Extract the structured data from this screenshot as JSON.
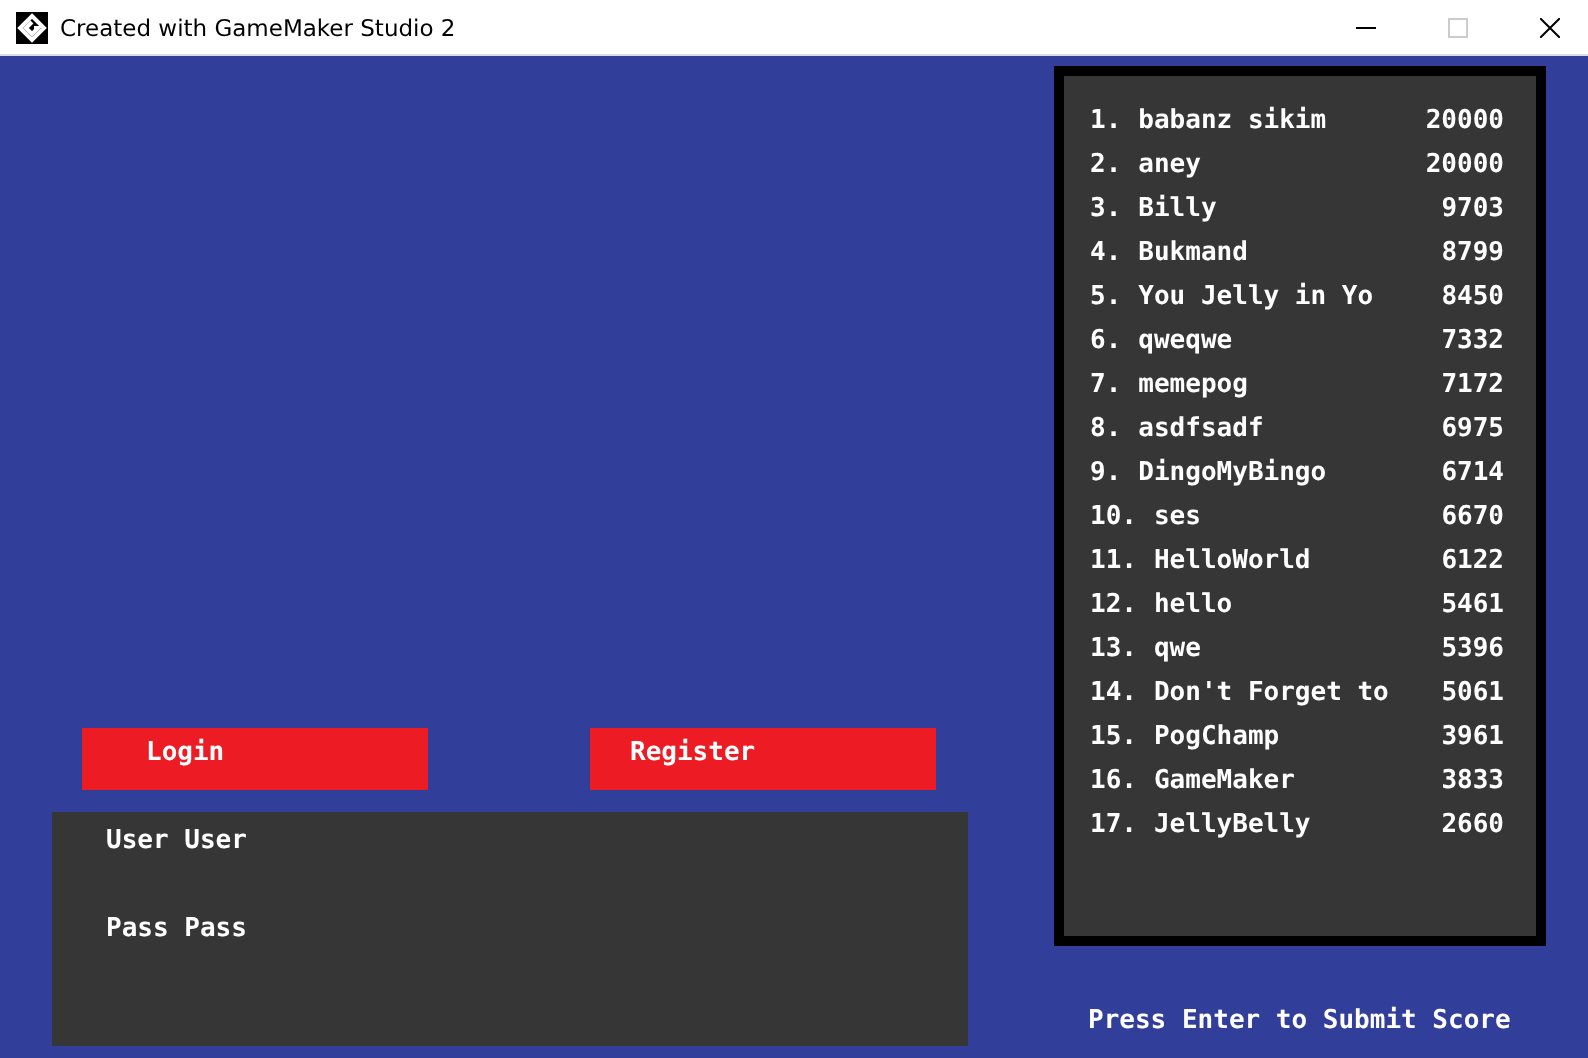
{
  "window": {
    "title": "Created with GameMaker Studio 2"
  },
  "buttons": [
    {
      "label": "Login"
    },
    {
      "label": "Register"
    }
  ],
  "login_panel": {
    "user_line": "User User",
    "pass_line": "Pass Pass"
  },
  "leaderboard": [
    {
      "rank": "1.",
      "name": "babanz sikim",
      "score": "20000"
    },
    {
      "rank": "2.",
      "name": "aney",
      "score": "20000"
    },
    {
      "rank": "3.",
      "name": "Billy",
      "score": "9703"
    },
    {
      "rank": "4.",
      "name": "Bukmand",
      "score": "8799"
    },
    {
      "rank": "5.",
      "name": "You Jelly in Yo",
      "score": "8450"
    },
    {
      "rank": "6.",
      "name": "qweqwe",
      "score": "7332"
    },
    {
      "rank": "7.",
      "name": "memepog",
      "score": "7172"
    },
    {
      "rank": "8.",
      "name": "asdfsadf",
      "score": "6975"
    },
    {
      "rank": "9.",
      "name": "DingoMyBingo",
      "score": "6714"
    },
    {
      "rank": "10.",
      "name": "ses",
      "score": "6670"
    },
    {
      "rank": "11.",
      "name": "HelloWorld",
      "score": "6122"
    },
    {
      "rank": "12.",
      "name": "hello",
      "score": "5461"
    },
    {
      "rank": "13.",
      "name": "qwe",
      "score": "5396"
    },
    {
      "rank": "14.",
      "name": "Don't Forget to",
      "score": "5061"
    },
    {
      "rank": "15.",
      "name": "PogChamp",
      "score": "3961"
    },
    {
      "rank": "16.",
      "name": "GameMaker",
      "score": "3833"
    },
    {
      "rank": "17.",
      "name": "JellyBelly",
      "score": "2660"
    }
  ],
  "hint": "Press Enter to Submit Score"
}
